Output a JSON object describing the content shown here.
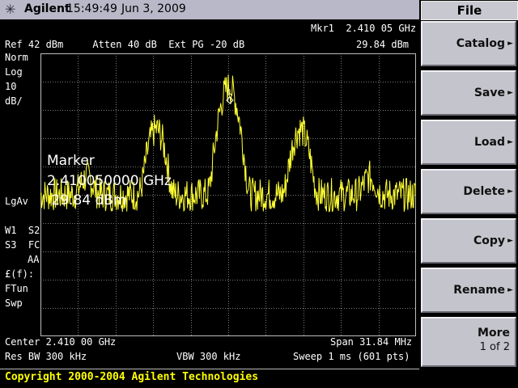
{
  "status_bar": {
    "brand": "Agilent",
    "time": "15:49:49",
    "date": "Jun 3, 2009"
  },
  "screen": {
    "marker_readout": "Mkr1  2.410 05 GHz",
    "marker_level": "29.84 dBm",
    "ref_line": "Ref 42 dBm     Atten 40 dB  Ext PG -20 dB",
    "left_annot": [
      "Norm",
      "Log",
      "10",
      "dB/"
    ],
    "marker_label": "1",
    "marker_box": {
      "title": "Marker",
      "freq": "2.410050000 GHz",
      "level": " 29.84 dBm"
    },
    "lgav": "LgAv",
    "w1s2": "W1  S2",
    "s3fc": "S3  FC",
    "aa": "AA",
    "ff": "£(f):",
    "ftun": "FTun",
    "swp": "Swp",
    "center": "Center 2.410 00 GHz",
    "span": "Span 31.84 MHz",
    "resbw": "Res BW 300 kHz",
    "vbw": "VBW 300 kHz",
    "sweep": "Sweep 1 ms (601 pts)"
  },
  "trace": {
    "color": "#ffff33",
    "peaks": [
      {
        "freq_offset_mhz": -12.0,
        "level_dbm": -3
      },
      {
        "freq_offset_mhz": -6.1,
        "level_dbm": 15
      },
      {
        "freq_offset_mhz": 0.05,
        "level_dbm": 29.84
      },
      {
        "freq_offset_mhz": 6.1,
        "level_dbm": 15
      },
      {
        "freq_offset_mhz": 12.0,
        "level_dbm": -3
      }
    ]
  },
  "panel": {
    "title": "File",
    "keys": [
      {
        "label": "Catalog",
        "arrow": "►"
      },
      {
        "label": "Save",
        "arrow": "►"
      },
      {
        "label": "Load",
        "arrow": "►"
      },
      {
        "label": "Delete",
        "arrow": "►"
      },
      {
        "label": "Copy",
        "arrow": "►"
      },
      {
        "label": "Rename",
        "arrow": "►"
      },
      {
        "label": "More",
        "sub": "1 of 2"
      }
    ]
  },
  "copyright": "Copyright 2000-2004 Agilent Technologies"
}
